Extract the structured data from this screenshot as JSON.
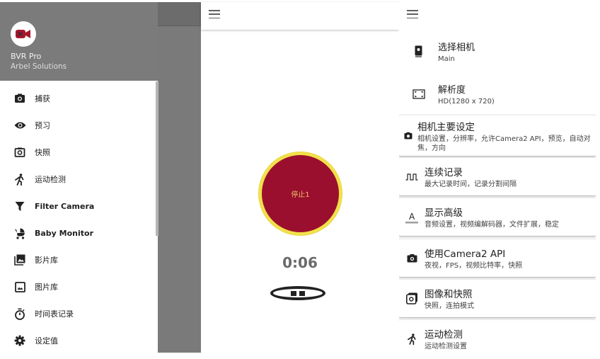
{
  "drawer": {
    "app_name": "BVR Pro",
    "company": "Arbel Solutions",
    "items": [
      {
        "label": "捕获",
        "icon": "camera-icon"
      },
      {
        "label": "预习",
        "icon": "eye-icon"
      },
      {
        "label": "快照",
        "icon": "snapshot-icon"
      },
      {
        "label": "运动检测",
        "icon": "running-person-icon"
      },
      {
        "label": "Filter Camera",
        "icon": "filter-icon"
      },
      {
        "label": "Baby Monitor",
        "icon": "stroller-icon"
      },
      {
        "label": "影片库",
        "icon": "video-library-icon"
      },
      {
        "label": "图片库",
        "icon": "image-icon"
      },
      {
        "label": "时间表记录",
        "icon": "timer-icon"
      },
      {
        "label": "设定值",
        "icon": "gear-icon"
      }
    ]
  },
  "capture": {
    "record_button_label": "停止1",
    "timer": "0:06"
  },
  "settings": {
    "rows": [
      {
        "title": "选择相机",
        "subtitle": "Main",
        "icon": "phone-camera-icon"
      },
      {
        "title": "解析度",
        "subtitle": "HD(1280 x 720)",
        "icon": "resolution-icon"
      }
    ],
    "cards": [
      {
        "title": "相机主要设定",
        "subtitle": "相机设置，分辨率，允许Camera2 API，预览，自动对焦，方向",
        "icon": "camera-icon"
      },
      {
        "title": "连续记录",
        "subtitle": "最大记录时间，记录分割间隔",
        "icon": "pulse-wave-icon"
      },
      {
        "title": "显示高级",
        "subtitle": "音频设置，视频编解码器，文件扩展，稳定",
        "icon": "text-format-icon"
      },
      {
        "title": "使用Camera2 API",
        "subtitle": "夜视，FPS，视频比特率，快照",
        "icon": "camera-icon"
      },
      {
        "title": "图像和快照",
        "subtitle": "快照，连拍模式",
        "icon": "photo-snapshot-icon"
      },
      {
        "title": "运动检测",
        "subtitle": "运动检测设置",
        "icon": "running-person-icon"
      }
    ]
  },
  "colors": {
    "record_red": "#9b0f2e",
    "record_ring": "#f2e14a",
    "drawer_header": "#7b7b7b",
    "scrim": "#7a7a7a"
  }
}
